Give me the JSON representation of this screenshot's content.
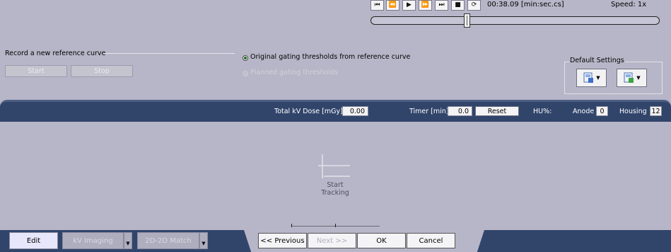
{
  "playback": {
    "icons": [
      "skip-start-icon",
      "rewind-icon",
      "play-icon",
      "fast-forward-icon",
      "skip-end-icon",
      "stop-icon",
      "loop-icon"
    ],
    "time": "00:38.09 [min:sec.cs]",
    "speed": "Speed: 1x",
    "position_fraction": 0.33
  },
  "reference": {
    "title": "Record a new reference curve",
    "start_label": "Start",
    "stop_label": "Stop"
  },
  "thresholds": {
    "option_original": "Original gating thresholds from reference curve",
    "option_planned": "Planned gating thresholds",
    "selected": "original"
  },
  "default_settings": {
    "title": "Default Settings",
    "icons": [
      "save-settings-icon",
      "load-settings-icon"
    ]
  },
  "status": {
    "dose_label": "Total kV Dose [mGy]",
    "dose_value": "0.00",
    "timer_label": "Timer [min]",
    "timer_value": "0.0",
    "reset_label": "Reset",
    "hu_label": "HU%:",
    "anode_label": "Anode",
    "anode_value": "0",
    "housing_label": "Housing",
    "housing_value": "12"
  },
  "tracking": {
    "label": "Start\nTracking"
  },
  "tabs": {
    "edit": "Edit",
    "kv_imaging": "kV Imaging",
    "match": "2D-2D Match"
  },
  "navigation": {
    "previous": "<< Previous",
    "next": "Next >>",
    "ok": "OK",
    "cancel": "Cancel"
  },
  "colors": {
    "background": "#b7b6c8",
    "bar": "#31456b",
    "active_tab": "#e7e6fb"
  }
}
